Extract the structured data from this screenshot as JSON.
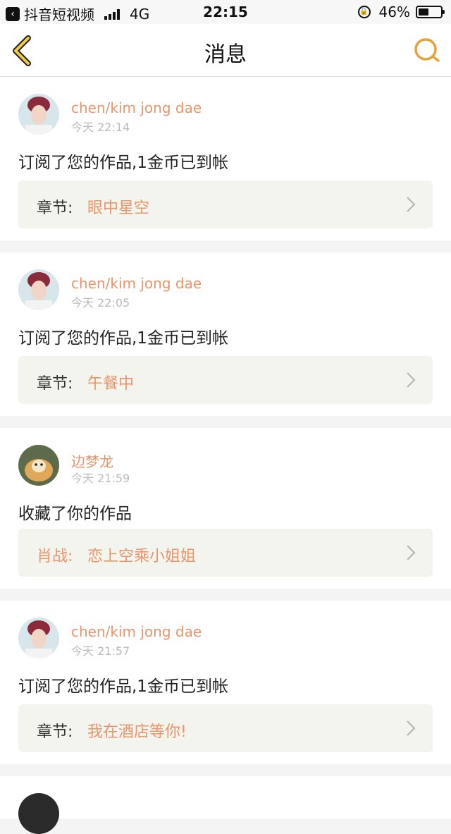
{
  "status_bar": {
    "app_name": "抖音短视频",
    "network": "4G",
    "time": "22:15",
    "battery": "46%",
    "battery_level": 0.46
  },
  "nav": {
    "title": "消息",
    "back_icon": "chevron-left-icon",
    "search_icon": "search-icon",
    "accent": "#e8a23a"
  },
  "messages": [
    {
      "username": "chen/kim jong dae",
      "time": "今天 22:14",
      "text": "订阅了您的作品,1金币已到帐",
      "chapter_label": "章节:",
      "chapter_title": "眼中星空"
    },
    {
      "username": "chen/kim jong dae",
      "time": "今天 22:05",
      "text": "订阅了您的作品,1金币已到帐",
      "chapter_label": "章节:",
      "chapter_title": "午餐中"
    },
    {
      "username": "边梦龙",
      "time": "今天 21:59",
      "text": "收藏了你的作品",
      "chapter_label": "肖战:",
      "chapter_title": "恋上空乘小姐姐"
    },
    {
      "username": "chen/kim jong dae",
      "time": "今天 21:57",
      "text": "订阅了您的作品,1金币已到帐",
      "chapter_label": "章节:",
      "chapter_title": "我在酒店等你!"
    }
  ],
  "colors": {
    "username": "#e8956c",
    "chapter_bg": "#f4f4ee",
    "page_bg": "#f4f4f4"
  }
}
